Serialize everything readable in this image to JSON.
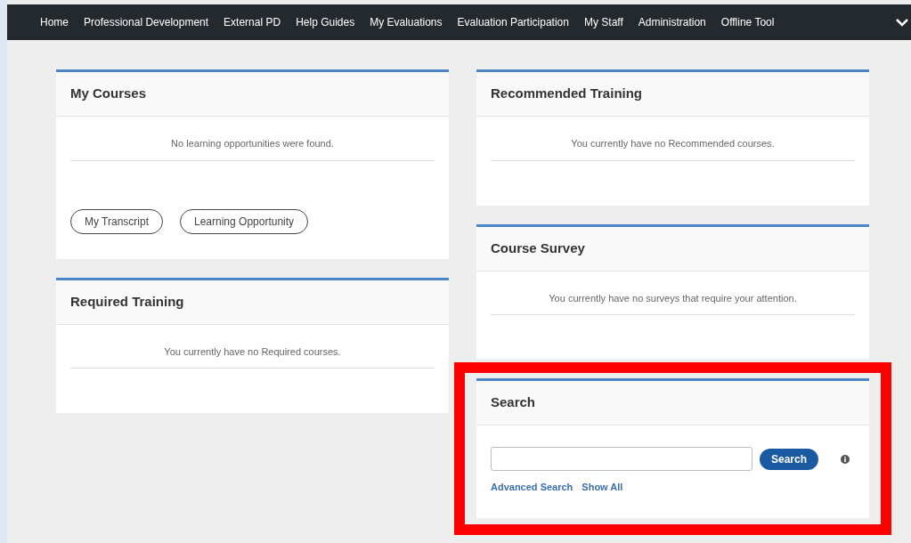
{
  "nav": {
    "items": [
      "Home",
      "Professional Development",
      "External PD",
      "Help Guides",
      "My Evaluations",
      "Evaluation Participation",
      "My Staff",
      "Administration",
      "Offline Tool"
    ],
    "expand_chevron": true
  },
  "left_column": [
    {
      "kind": "message",
      "title": "My Courses",
      "message": "No learning opportunities were found.",
      "buttons": [
        "My Transcript",
        "Learning Opportunity"
      ]
    },
    {
      "kind": "message",
      "title": "Required Training",
      "message": "You currently have no Required courses."
    }
  ],
  "right_column": [
    {
      "kind": "message",
      "title": "Recommended Training",
      "message": "You currently have no Recommended courses."
    },
    {
      "kind": "message",
      "title": "Course Survey",
      "message": "You currently have no surveys that require your attention."
    },
    {
      "kind": "search",
      "title": "Search",
      "search_button": "Search",
      "links": [
        "Advanced Search",
        "Show All"
      ],
      "highlighted": true
    }
  ]
}
